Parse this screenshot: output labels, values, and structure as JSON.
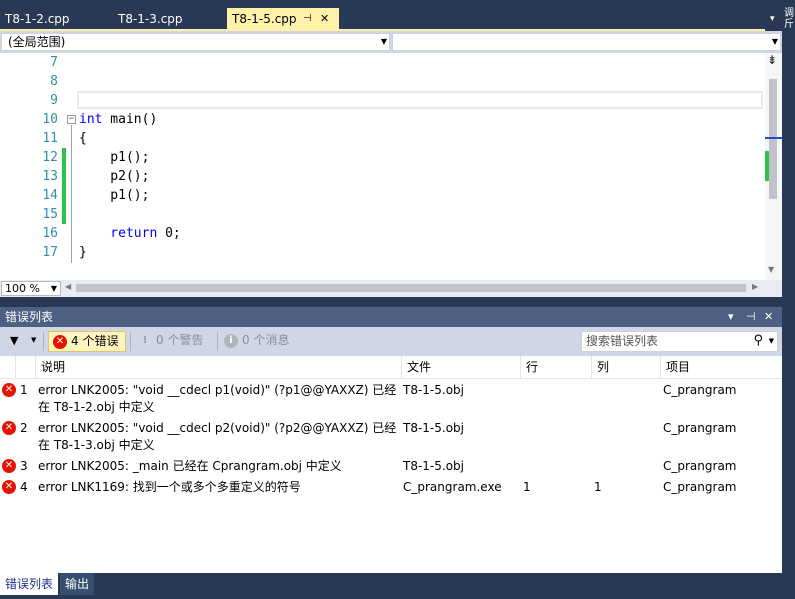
{
  "tabs": [
    {
      "label": "T8-1-2.cpp",
      "active": false
    },
    {
      "label": "T8-1-3.cpp",
      "active": false
    },
    {
      "label": "T8-1-5.cpp",
      "active": true
    }
  ],
  "tab_pin": "⊣",
  "tab_close": "✕",
  "overflow_glyph": "▾",
  "right_strip_chars": [
    "调",
    "斤"
  ],
  "nav": {
    "scope": "(全局范围)",
    "member": ""
  },
  "code": {
    "lines": [
      {
        "num": "7",
        "text": ""
      },
      {
        "num": "8",
        "text": ""
      },
      {
        "num": "9",
        "text": ""
      },
      {
        "num": "10",
        "kw": "int",
        "text": " main()"
      },
      {
        "num": "11",
        "text": "{"
      },
      {
        "num": "12",
        "text": "    p1();"
      },
      {
        "num": "13",
        "text": "    p2();"
      },
      {
        "num": "14",
        "text": "    p1();"
      },
      {
        "num": "15",
        "text": ""
      },
      {
        "num": "16",
        "kw": "    return",
        "text": " 0;"
      },
      {
        "num": "17",
        "text": "}"
      }
    ],
    "collapse_glyph": "−"
  },
  "zoom": "100 %",
  "error_list": {
    "title": "错误列表",
    "title_controls": [
      "▾",
      "⊣",
      "✕"
    ],
    "toolbar": {
      "errors": "4 个错误",
      "warnings": "0 个警告",
      "messages": "0 个消息",
      "search_placeholder": "搜索错误列表"
    },
    "columns": [
      "说明",
      "文件",
      "行",
      "列",
      "项目"
    ],
    "rows": [
      {
        "num": "1",
        "desc1": "error LNK2005: \"void __cdecl p1(void)\" (?p1@@YAXXZ) 已经",
        "desc2": "在 T8-1-2.obj 中定义",
        "file": "T8-1-5.obj",
        "line": "",
        "col": "",
        "project": "C_prangram"
      },
      {
        "num": "2",
        "desc1": "error LNK2005: \"void __cdecl p2(void)\" (?p2@@YAXXZ) 已经",
        "desc2": "在 T8-1-3.obj 中定义",
        "file": "T8-1-5.obj",
        "line": "",
        "col": "",
        "project": "C_prangram"
      },
      {
        "num": "3",
        "desc1": "error LNK2005: _main 已经在 Cprangram.obj 中定义",
        "desc2": "",
        "file": "T8-1-5.obj",
        "line": "",
        "col": "",
        "project": "C_prangram"
      },
      {
        "num": "4",
        "desc1": "error LNK1169: 找到一个或多个多重定义的符号",
        "desc2": "",
        "file": "C_prangram.exe",
        "line": "1",
        "col": "1",
        "project": "C_prangram"
      }
    ]
  },
  "bottom_tabs": [
    "错误列表",
    "输出"
  ],
  "colors": {
    "chrome": "#293955",
    "active_tab": "#fff1a8",
    "error": "#e51400",
    "keyword": "#0000ff",
    "line_number": "#2b91af",
    "change_bar": "#2ec24a"
  }
}
